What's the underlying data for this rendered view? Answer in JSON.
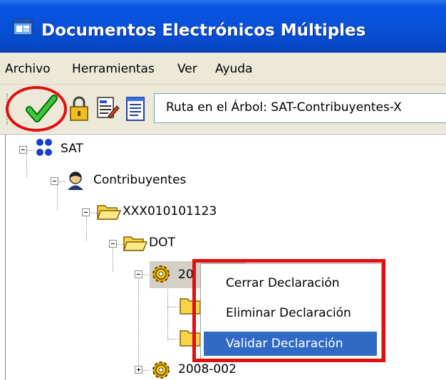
{
  "window": {
    "title": "Documentos Electrónicos Múltiples",
    "app_icon": "app-window-icon"
  },
  "menu": {
    "items": [
      {
        "label": "Archivo"
      },
      {
        "label": "Herramientas"
      },
      {
        "label": "Ver"
      },
      {
        "label": "Ayuda"
      }
    ]
  },
  "toolbar": {
    "buttons": [
      {
        "icon": "checkmark-icon",
        "highlighted": true
      },
      {
        "icon": "lock-icon"
      },
      {
        "icon": "edit-icon"
      },
      {
        "icon": "notepad-icon"
      }
    ],
    "path_text": "Ruta en el Árbol: SAT-Contribuyentes-X"
  },
  "tree": {
    "nodes": [
      {
        "label": "SAT",
        "icon": "org-icon",
        "expanded": true
      },
      {
        "label": "Contribuyentes",
        "icon": "person-icon",
        "expanded": true
      },
      {
        "label": "XXX010101123",
        "icon": "folder-open-icon",
        "expanded": true
      },
      {
        "label": "DOT",
        "icon": "folder-open-icon",
        "expanded": true
      },
      {
        "label": "20",
        "icon": "gear-icon",
        "expanded": true,
        "selected": true
      },
      {
        "label": "",
        "icon": "folder-icon"
      },
      {
        "label": "",
        "icon": "folder-icon"
      },
      {
        "label": "2008-002",
        "icon": "gear-icon",
        "expanded": false
      }
    ]
  },
  "context_menu": {
    "items": [
      {
        "label": "Cerrar Declaración",
        "highlighted": false
      },
      {
        "label": "Eliminar Declaración",
        "highlighted": false
      },
      {
        "label": "Validar Declaración",
        "highlighted": true
      }
    ]
  },
  "colors": {
    "titlebar": "#0850d8",
    "highlight": "#316ac5",
    "annotation_red": "#e01010",
    "chrome": "#ece9d8"
  }
}
